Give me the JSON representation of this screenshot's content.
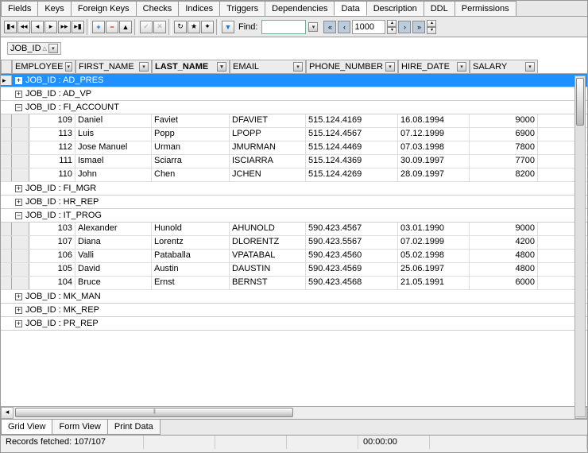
{
  "tabs_top": [
    "Fields",
    "Keys",
    "Foreign Keys",
    "Checks",
    "Indices",
    "Triggers",
    "Dependencies",
    "Data",
    "Description",
    "DDL",
    "Permissions"
  ],
  "tabs_top_active": "Data",
  "toolbar": {
    "find_label": "Find:",
    "page_value": "1000"
  },
  "group_by": {
    "field": "JOB_ID"
  },
  "columns": [
    "EMPLOYEE",
    "FIRST_NAME",
    "LAST_NAME",
    "EMAIL",
    "PHONE_NUMBER",
    "HIRE_DATE",
    "SALARY"
  ],
  "sorted_col": "LAST_NAME",
  "groups": [
    {
      "label": "JOB_ID : AD_PRES",
      "expanded": false,
      "selected": true,
      "rows": []
    },
    {
      "label": "JOB_ID : AD_VP",
      "expanded": false,
      "rows": []
    },
    {
      "label": "JOB_ID : FI_ACCOUNT",
      "expanded": true,
      "rows": [
        {
          "emp": "109",
          "first": "Daniel",
          "last": "Faviet",
          "email": "DFAVIET",
          "phone": "515.124.4169",
          "hire": "16.08.1994",
          "sal": "9000"
        },
        {
          "emp": "113",
          "first": "Luis",
          "last": "Popp",
          "email": "LPOPP",
          "phone": "515.124.4567",
          "hire": "07.12.1999",
          "sal": "6900"
        },
        {
          "emp": "112",
          "first": "Jose Manuel",
          "last": "Urman",
          "email": "JMURMAN",
          "phone": "515.124.4469",
          "hire": "07.03.1998",
          "sal": "7800"
        },
        {
          "emp": "111",
          "first": "Ismael",
          "last": "Sciarra",
          "email": "ISCIARRA",
          "phone": "515.124.4369",
          "hire": "30.09.1997",
          "sal": "7700"
        },
        {
          "emp": "110",
          "first": "John",
          "last": "Chen",
          "email": "JCHEN",
          "phone": "515.124.4269",
          "hire": "28.09.1997",
          "sal": "8200"
        }
      ]
    },
    {
      "label": "JOB_ID : FI_MGR",
      "expanded": false,
      "rows": []
    },
    {
      "label": "JOB_ID : HR_REP",
      "expanded": false,
      "rows": []
    },
    {
      "label": "JOB_ID : IT_PROG",
      "expanded": true,
      "rows": [
        {
          "emp": "103",
          "first": "Alexander",
          "last": "Hunold",
          "email": "AHUNOLD",
          "phone": "590.423.4567",
          "hire": "03.01.1990",
          "sal": "9000"
        },
        {
          "emp": "107",
          "first": "Diana",
          "last": "Lorentz",
          "email": "DLORENTZ",
          "phone": "590.423.5567",
          "hire": "07.02.1999",
          "sal": "4200"
        },
        {
          "emp": "106",
          "first": "Valli",
          "last": "Pataballa",
          "email": "VPATABAL",
          "phone": "590.423.4560",
          "hire": "05.02.1998",
          "sal": "4800"
        },
        {
          "emp": "105",
          "first": "David",
          "last": "Austin",
          "email": "DAUSTIN",
          "phone": "590.423.4569",
          "hire": "25.06.1997",
          "sal": "4800"
        },
        {
          "emp": "104",
          "first": "Bruce",
          "last": "Ernst",
          "email": "BERNST",
          "phone": "590.423.4568",
          "hire": "21.05.1991",
          "sal": "6000"
        }
      ]
    },
    {
      "label": "JOB_ID : MK_MAN",
      "expanded": false,
      "rows": []
    },
    {
      "label": "JOB_ID : MK_REP",
      "expanded": false,
      "rows": []
    },
    {
      "label": "JOB_ID : PR_REP",
      "expanded": false,
      "rows": []
    }
  ],
  "bottom_tabs": [
    "Grid View",
    "Form View",
    "Print Data"
  ],
  "bottom_active": "Grid View",
  "status": {
    "records": "Records fetched: 107/107",
    "time": "00:00:00"
  }
}
